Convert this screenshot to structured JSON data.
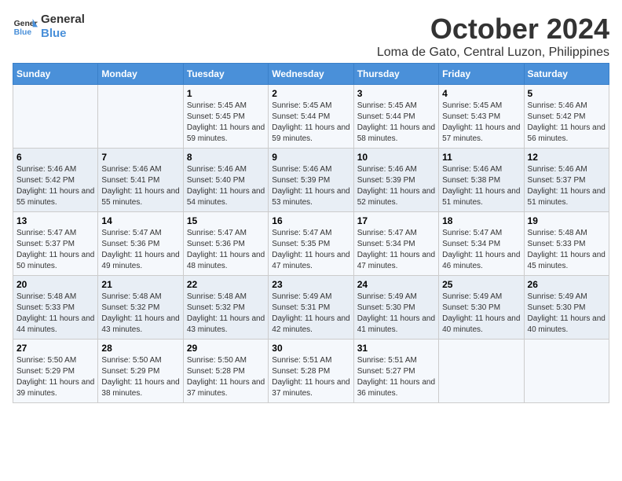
{
  "logo": {
    "line1": "General",
    "line2": "Blue"
  },
  "title": "October 2024",
  "subtitle": "Loma de Gato, Central Luzon, Philippines",
  "headers": [
    "Sunday",
    "Monday",
    "Tuesday",
    "Wednesday",
    "Thursday",
    "Friday",
    "Saturday"
  ],
  "weeks": [
    [
      {
        "day": "",
        "sunrise": "",
        "sunset": "",
        "daylight": ""
      },
      {
        "day": "",
        "sunrise": "",
        "sunset": "",
        "daylight": ""
      },
      {
        "day": "1",
        "sunrise": "Sunrise: 5:45 AM",
        "sunset": "Sunset: 5:45 PM",
        "daylight": "Daylight: 11 hours and 59 minutes."
      },
      {
        "day": "2",
        "sunrise": "Sunrise: 5:45 AM",
        "sunset": "Sunset: 5:44 PM",
        "daylight": "Daylight: 11 hours and 59 minutes."
      },
      {
        "day": "3",
        "sunrise": "Sunrise: 5:45 AM",
        "sunset": "Sunset: 5:44 PM",
        "daylight": "Daylight: 11 hours and 58 minutes."
      },
      {
        "day": "4",
        "sunrise": "Sunrise: 5:45 AM",
        "sunset": "Sunset: 5:43 PM",
        "daylight": "Daylight: 11 hours and 57 minutes."
      },
      {
        "day": "5",
        "sunrise": "Sunrise: 5:46 AM",
        "sunset": "Sunset: 5:42 PM",
        "daylight": "Daylight: 11 hours and 56 minutes."
      }
    ],
    [
      {
        "day": "6",
        "sunrise": "Sunrise: 5:46 AM",
        "sunset": "Sunset: 5:42 PM",
        "daylight": "Daylight: 11 hours and 55 minutes."
      },
      {
        "day": "7",
        "sunrise": "Sunrise: 5:46 AM",
        "sunset": "Sunset: 5:41 PM",
        "daylight": "Daylight: 11 hours and 55 minutes."
      },
      {
        "day": "8",
        "sunrise": "Sunrise: 5:46 AM",
        "sunset": "Sunset: 5:40 PM",
        "daylight": "Daylight: 11 hours and 54 minutes."
      },
      {
        "day": "9",
        "sunrise": "Sunrise: 5:46 AM",
        "sunset": "Sunset: 5:39 PM",
        "daylight": "Daylight: 11 hours and 53 minutes."
      },
      {
        "day": "10",
        "sunrise": "Sunrise: 5:46 AM",
        "sunset": "Sunset: 5:39 PM",
        "daylight": "Daylight: 11 hours and 52 minutes."
      },
      {
        "day": "11",
        "sunrise": "Sunrise: 5:46 AM",
        "sunset": "Sunset: 5:38 PM",
        "daylight": "Daylight: 11 hours and 51 minutes."
      },
      {
        "day": "12",
        "sunrise": "Sunrise: 5:46 AM",
        "sunset": "Sunset: 5:37 PM",
        "daylight": "Daylight: 11 hours and 51 minutes."
      }
    ],
    [
      {
        "day": "13",
        "sunrise": "Sunrise: 5:47 AM",
        "sunset": "Sunset: 5:37 PM",
        "daylight": "Daylight: 11 hours and 50 minutes."
      },
      {
        "day": "14",
        "sunrise": "Sunrise: 5:47 AM",
        "sunset": "Sunset: 5:36 PM",
        "daylight": "Daylight: 11 hours and 49 minutes."
      },
      {
        "day": "15",
        "sunrise": "Sunrise: 5:47 AM",
        "sunset": "Sunset: 5:36 PM",
        "daylight": "Daylight: 11 hours and 48 minutes."
      },
      {
        "day": "16",
        "sunrise": "Sunrise: 5:47 AM",
        "sunset": "Sunset: 5:35 PM",
        "daylight": "Daylight: 11 hours and 47 minutes."
      },
      {
        "day": "17",
        "sunrise": "Sunrise: 5:47 AM",
        "sunset": "Sunset: 5:34 PM",
        "daylight": "Daylight: 11 hours and 47 minutes."
      },
      {
        "day": "18",
        "sunrise": "Sunrise: 5:47 AM",
        "sunset": "Sunset: 5:34 PM",
        "daylight": "Daylight: 11 hours and 46 minutes."
      },
      {
        "day": "19",
        "sunrise": "Sunrise: 5:48 AM",
        "sunset": "Sunset: 5:33 PM",
        "daylight": "Daylight: 11 hours and 45 minutes."
      }
    ],
    [
      {
        "day": "20",
        "sunrise": "Sunrise: 5:48 AM",
        "sunset": "Sunset: 5:33 PM",
        "daylight": "Daylight: 11 hours and 44 minutes."
      },
      {
        "day": "21",
        "sunrise": "Sunrise: 5:48 AM",
        "sunset": "Sunset: 5:32 PM",
        "daylight": "Daylight: 11 hours and 43 minutes."
      },
      {
        "day": "22",
        "sunrise": "Sunrise: 5:48 AM",
        "sunset": "Sunset: 5:32 PM",
        "daylight": "Daylight: 11 hours and 43 minutes."
      },
      {
        "day": "23",
        "sunrise": "Sunrise: 5:49 AM",
        "sunset": "Sunset: 5:31 PM",
        "daylight": "Daylight: 11 hours and 42 minutes."
      },
      {
        "day": "24",
        "sunrise": "Sunrise: 5:49 AM",
        "sunset": "Sunset: 5:30 PM",
        "daylight": "Daylight: 11 hours and 41 minutes."
      },
      {
        "day": "25",
        "sunrise": "Sunrise: 5:49 AM",
        "sunset": "Sunset: 5:30 PM",
        "daylight": "Daylight: 11 hours and 40 minutes."
      },
      {
        "day": "26",
        "sunrise": "Sunrise: 5:49 AM",
        "sunset": "Sunset: 5:30 PM",
        "daylight": "Daylight: 11 hours and 40 minutes."
      }
    ],
    [
      {
        "day": "27",
        "sunrise": "Sunrise: 5:50 AM",
        "sunset": "Sunset: 5:29 PM",
        "daylight": "Daylight: 11 hours and 39 minutes."
      },
      {
        "day": "28",
        "sunrise": "Sunrise: 5:50 AM",
        "sunset": "Sunset: 5:29 PM",
        "daylight": "Daylight: 11 hours and 38 minutes."
      },
      {
        "day": "29",
        "sunrise": "Sunrise: 5:50 AM",
        "sunset": "Sunset: 5:28 PM",
        "daylight": "Daylight: 11 hours and 37 minutes."
      },
      {
        "day": "30",
        "sunrise": "Sunrise: 5:51 AM",
        "sunset": "Sunset: 5:28 PM",
        "daylight": "Daylight: 11 hours and 37 minutes."
      },
      {
        "day": "31",
        "sunrise": "Sunrise: 5:51 AM",
        "sunset": "Sunset: 5:27 PM",
        "daylight": "Daylight: 11 hours and 36 minutes."
      },
      {
        "day": "",
        "sunrise": "",
        "sunset": "",
        "daylight": ""
      },
      {
        "day": "",
        "sunrise": "",
        "sunset": "",
        "daylight": ""
      }
    ]
  ]
}
